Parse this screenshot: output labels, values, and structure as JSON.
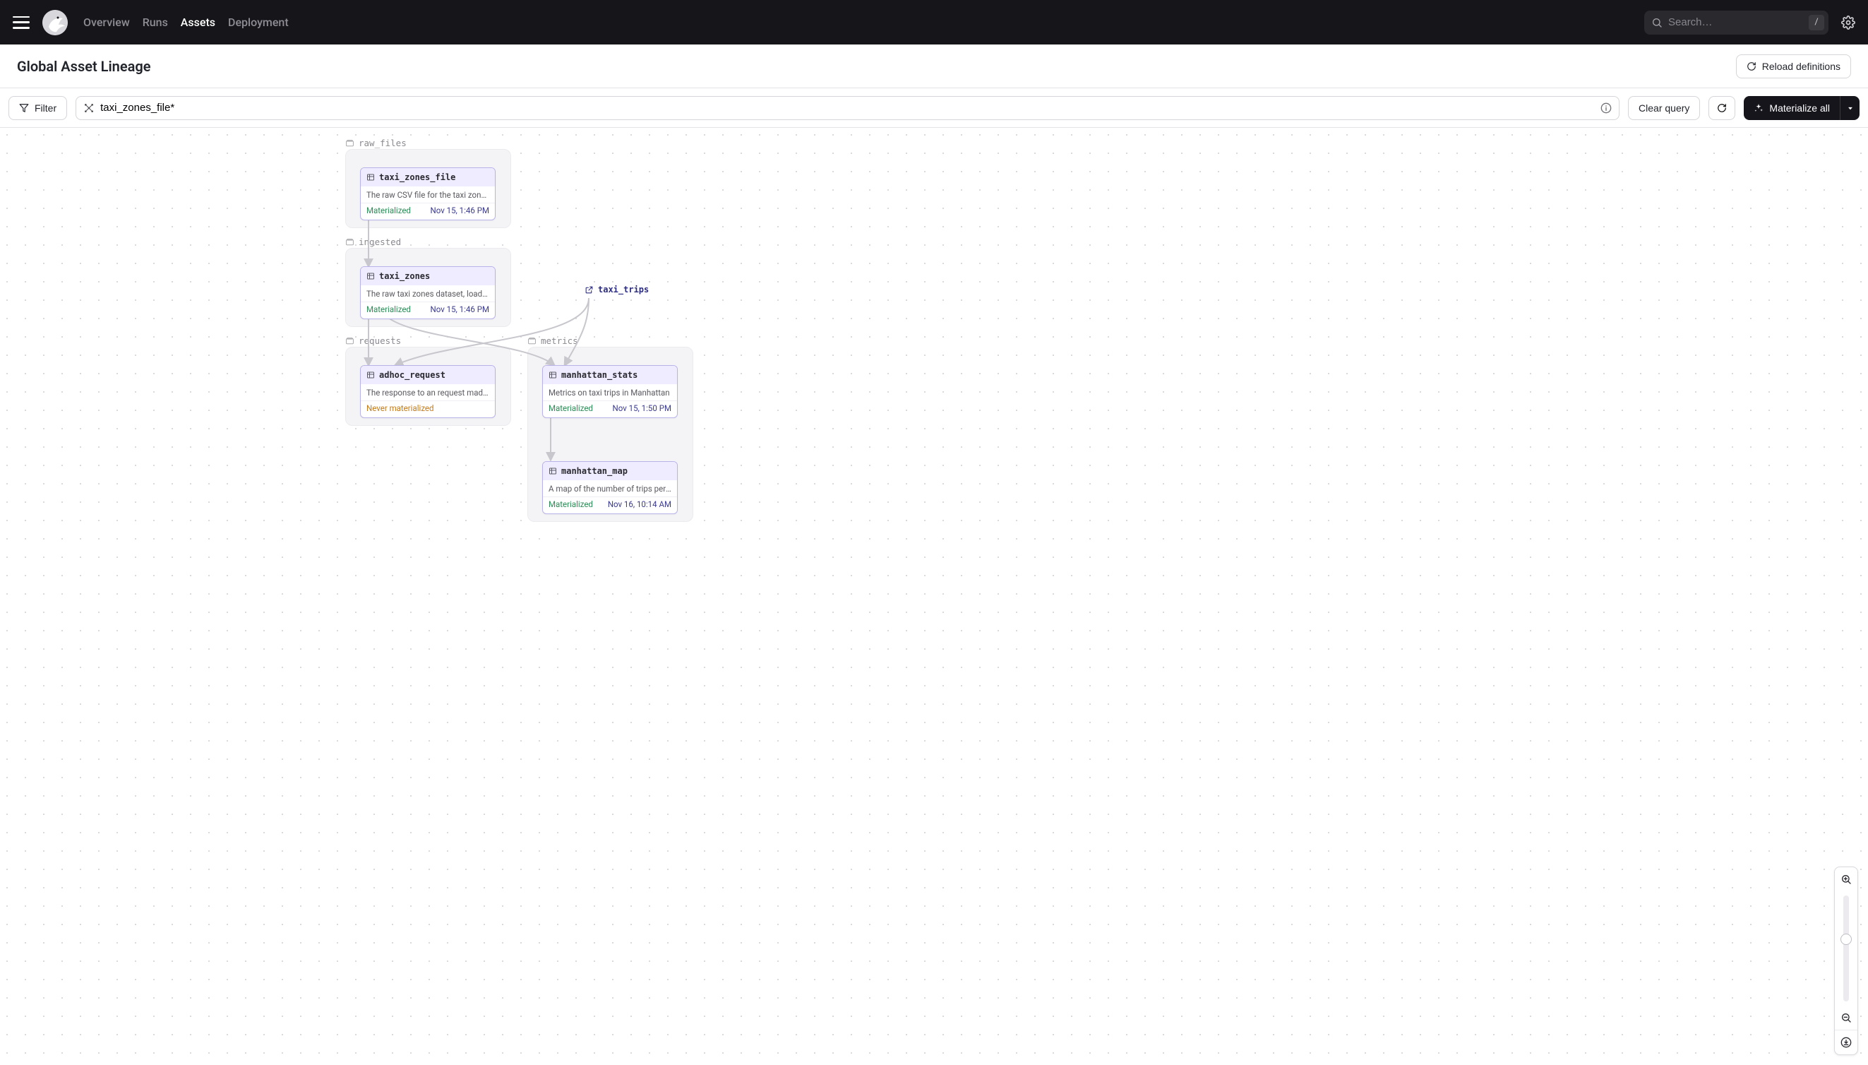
{
  "nav": {
    "links": [
      "Overview",
      "Runs",
      "Assets",
      "Deployment"
    ],
    "active": "Assets",
    "search_placeholder": "Search…",
    "search_key": "/"
  },
  "header": {
    "title": "Global Asset Lineage",
    "reload_label": "Reload definitions"
  },
  "toolbar": {
    "filter_label": "Filter",
    "query_value": "taxi_zones_file*",
    "clear_label": "Clear query",
    "materialize_label": "Materialize all"
  },
  "groups": {
    "raw_files": {
      "label": "raw_files"
    },
    "ingested": {
      "label": "ingested"
    },
    "requests": {
      "label": "requests"
    },
    "metrics": {
      "label": "metrics"
    }
  },
  "external": {
    "taxi_trips": {
      "name": "taxi_trips"
    }
  },
  "assets": {
    "taxi_zones_file": {
      "name": "taxi_zones_file",
      "desc": "The raw CSV file for the taxi zones dat…",
      "status": "Materialized",
      "status_class": "status-mat",
      "ts": "Nov 15, 1:46 PM"
    },
    "taxi_zones": {
      "name": "taxi_zones",
      "desc": "The raw taxi zones dataset, loaded int…",
      "status": "Materialized",
      "status_class": "status-mat",
      "ts": "Nov 15, 1:46 PM"
    },
    "adhoc_request": {
      "name": "adhoc_request",
      "desc": "The response to an request made in th…",
      "status": "Never materialized",
      "status_class": "status-never",
      "ts": ""
    },
    "manhattan_stats": {
      "name": "manhattan_stats",
      "desc": "Metrics on taxi trips in Manhattan",
      "status": "Materialized",
      "status_class": "status-mat",
      "ts": "Nov 15, 1:50 PM"
    },
    "manhattan_map": {
      "name": "manhattan_map",
      "desc": "A map of the number of trips per taxi z…",
      "status": "Materialized",
      "status_class": "status-mat",
      "ts": "Nov 16, 10:14 AM"
    }
  }
}
